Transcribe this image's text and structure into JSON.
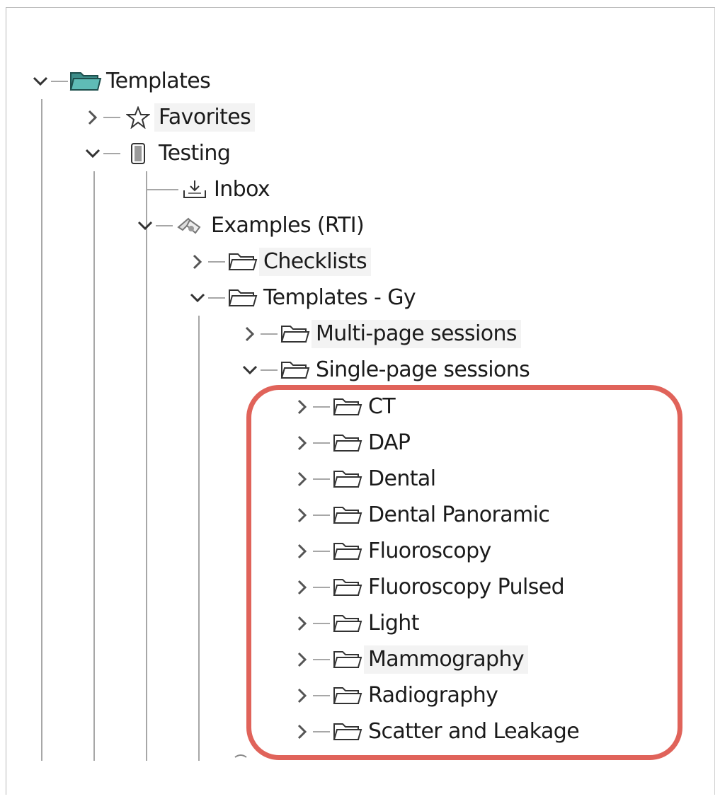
{
  "tree": {
    "root": {
      "label": "Templates",
      "icon": "folder-open-teal-icon",
      "expanded": true
    },
    "favorites": {
      "label": "Favorites",
      "icon": "star-icon",
      "expanded": false
    },
    "testing": {
      "label": "Testing",
      "icon": "database-icon",
      "expanded": true
    },
    "inbox": {
      "label": "Inbox",
      "icon": "inbox-icon"
    },
    "examples": {
      "label": "Examples (RTI)",
      "icon": "shared-folder-icon",
      "expanded": true
    },
    "checklists": {
      "label": "Checklists",
      "icon": "folder-icon",
      "expanded": false
    },
    "templates_gy": {
      "label": "Templates - Gy",
      "icon": "folder-icon",
      "expanded": true
    },
    "multi_page": {
      "label": "Multi-page sessions",
      "icon": "folder-icon",
      "expanded": false
    },
    "single_page": {
      "label": "Single-page sessions",
      "icon": "folder-icon",
      "expanded": true
    },
    "single_page_children": [
      {
        "label": "CT"
      },
      {
        "label": "DAP"
      },
      {
        "label": "Dental"
      },
      {
        "label": "Dental Panoramic"
      },
      {
        "label": "Fluoroscopy"
      },
      {
        "label": "Fluoroscopy Pulsed"
      },
      {
        "label": "Light"
      },
      {
        "label": "Mammography"
      },
      {
        "label": "Radiography"
      },
      {
        "label": "Scatter and Leakage"
      }
    ]
  },
  "colors": {
    "highlight_outline": "#e0635a",
    "tree_lines": "#a7a7a7",
    "root_folder": "#4fa7a2"
  }
}
